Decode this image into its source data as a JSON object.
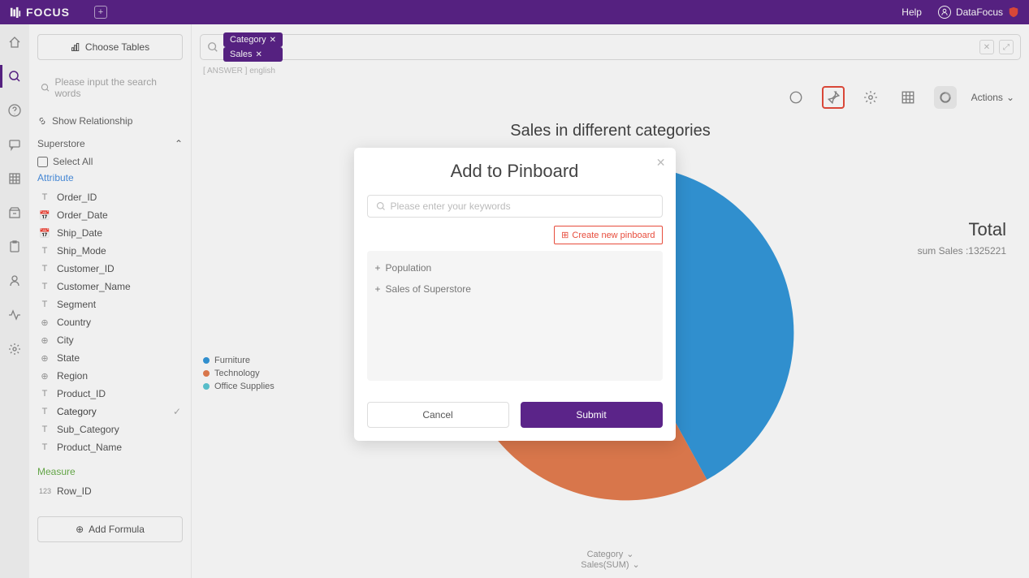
{
  "header": {
    "app_name": "FOCUS",
    "help": "Help",
    "user": "DataFocus"
  },
  "sidebar": {
    "choose_tables": "Choose Tables",
    "search_placeholder": "Please input the search words",
    "show_relationship": "Show Relationship",
    "table_name": "Superstore",
    "select_all": "Select All",
    "attribute_label": "Attribute",
    "measure_label": "Measure",
    "attributes": [
      {
        "icon": "T",
        "name": "Order_ID"
      },
      {
        "icon": "cal",
        "name": "Order_Date"
      },
      {
        "icon": "cal",
        "name": "Ship_Date"
      },
      {
        "icon": "T",
        "name": "Ship_Mode"
      },
      {
        "icon": "T",
        "name": "Customer_ID"
      },
      {
        "icon": "T",
        "name": "Customer_Name"
      },
      {
        "icon": "T",
        "name": "Segment"
      },
      {
        "icon": "geo",
        "name": "Country"
      },
      {
        "icon": "geo",
        "name": "City"
      },
      {
        "icon": "geo",
        "name": "State"
      },
      {
        "icon": "geo",
        "name": "Region"
      },
      {
        "icon": "T",
        "name": "Product_ID"
      },
      {
        "icon": "T",
        "name": "Category",
        "selected": true
      },
      {
        "icon": "T",
        "name": "Sub_Category"
      },
      {
        "icon": "T",
        "name": "Product_Name"
      }
    ],
    "measures": [
      {
        "icon": "123",
        "name": "Row_ID"
      }
    ],
    "add_formula": "Add Formula"
  },
  "query": {
    "chips": [
      "Category",
      "Sales"
    ],
    "breadcrumb": "[ ANSWER ]  english"
  },
  "toolbar": {
    "actions": "Actions"
  },
  "chart": {
    "title": "Sales in different categories",
    "legend": [
      {
        "color": "#3498db",
        "label": "Furniture"
      },
      {
        "color": "#e67e50",
        "label": "Technology"
      },
      {
        "color": "#5dc9d6",
        "label": "Office Supplies"
      }
    ],
    "total_label": "Total",
    "total_sub": "sum Sales :1325221",
    "axis1": "Category",
    "axis2": "Sales(SUM)"
  },
  "chart_data": {
    "type": "pie",
    "title": "Sales in different categories",
    "total": 1325221,
    "series": [
      {
        "name": "Furniture",
        "value": 556593,
        "color": "#3498db"
      },
      {
        "name": "Technology",
        "value": 530088,
        "color": "#e67e50"
      },
      {
        "name": "Office Supplies",
        "value": 238540,
        "color": "#5dc9d6"
      }
    ]
  },
  "modal": {
    "title": "Add to Pinboard",
    "search_placeholder": "Please enter your keywords",
    "create_new": "Create new pinboard",
    "pinboards": [
      "Population",
      "Sales of Superstore"
    ],
    "cancel": "Cancel",
    "submit": "Submit"
  }
}
